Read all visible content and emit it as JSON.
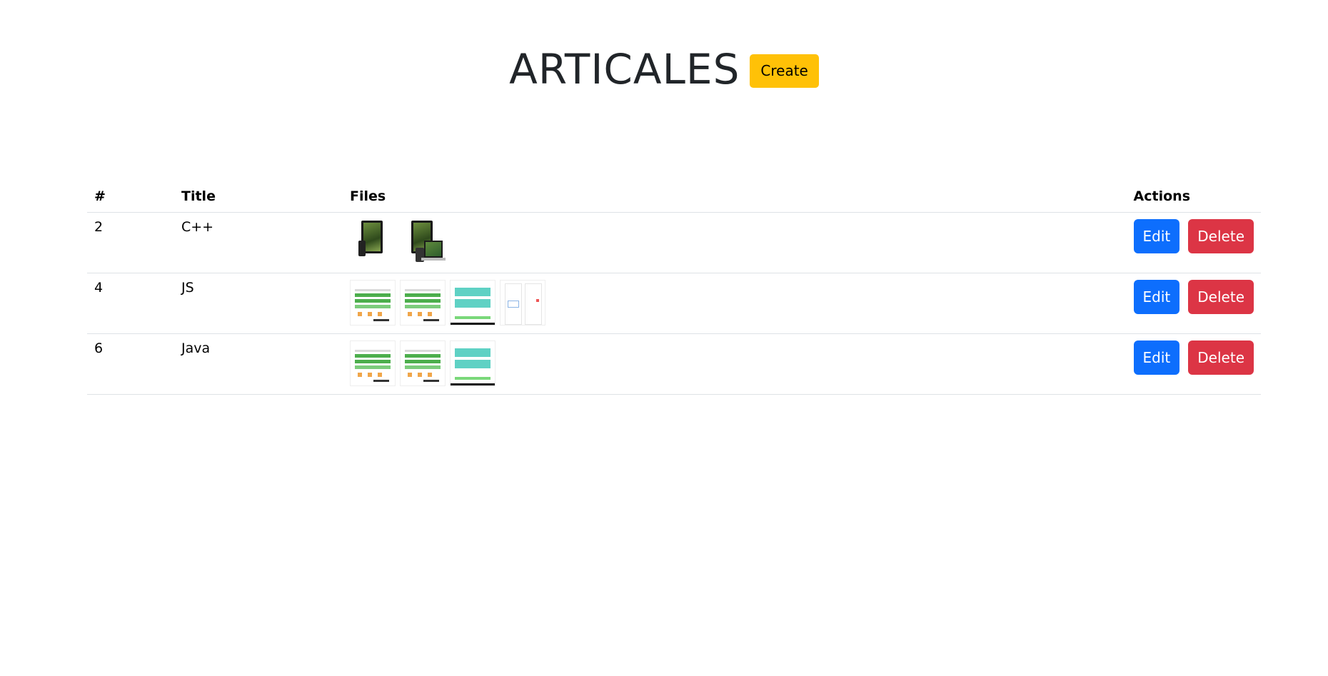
{
  "header": {
    "title": "ARTICALES",
    "create_label": "Create"
  },
  "table": {
    "columns": [
      "#",
      "Title",
      "Files",
      "Actions"
    ],
    "rows": [
      {
        "id": "2",
        "title": "C++",
        "files": [
          "device-mockup",
          "device-mockup"
        ]
      },
      {
        "id": "4",
        "title": "JS",
        "files": [
          "green-screenshot",
          "green-screenshot",
          "teal-screenshot",
          "light-screenshot"
        ]
      },
      {
        "id": "6",
        "title": "Java",
        "files": [
          "green-screenshot",
          "green-screenshot",
          "teal-screenshot"
        ]
      }
    ],
    "edit_label": "Edit",
    "delete_label": "Delete"
  },
  "colors": {
    "create": "#ffc107",
    "edit": "#0d6efd",
    "delete": "#dc3545",
    "title": "#212529"
  }
}
